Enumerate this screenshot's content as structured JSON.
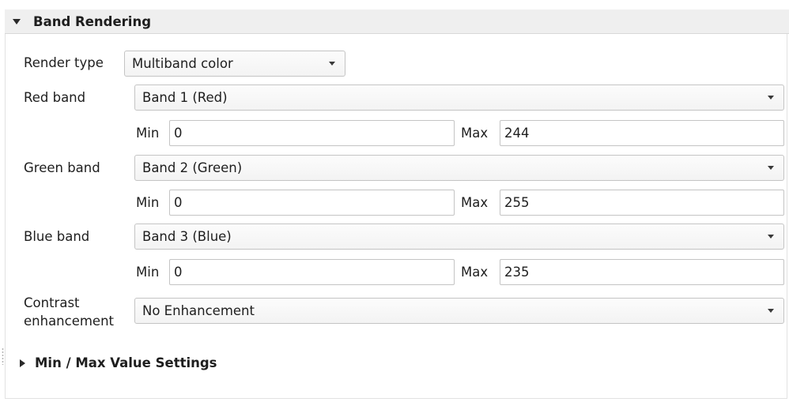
{
  "section": {
    "title": "Band Rendering",
    "expander_icon": "triangle-down"
  },
  "render_type": {
    "label": "Render type",
    "value": "Multiband color"
  },
  "bands": [
    {
      "label": "Red band",
      "value": "Band 1 (Red)",
      "min_label": "Min",
      "min": "0",
      "max_label": "Max",
      "max": "244"
    },
    {
      "label": "Green band",
      "value": "Band 2 (Green)",
      "min_label": "Min",
      "min": "0",
      "max_label": "Max",
      "max": "255"
    },
    {
      "label": "Blue band",
      "value": "Band 3 (Blue)",
      "min_label": "Min",
      "min": "0",
      "max_label": "Max",
      "max": "235"
    }
  ],
  "contrast": {
    "label_line1": "Contrast",
    "label_line2": "enhancement",
    "value": "No Enhancement"
  },
  "min_max_settings": {
    "title": "Min / Max Value Settings",
    "expander_icon": "triangle-right"
  }
}
